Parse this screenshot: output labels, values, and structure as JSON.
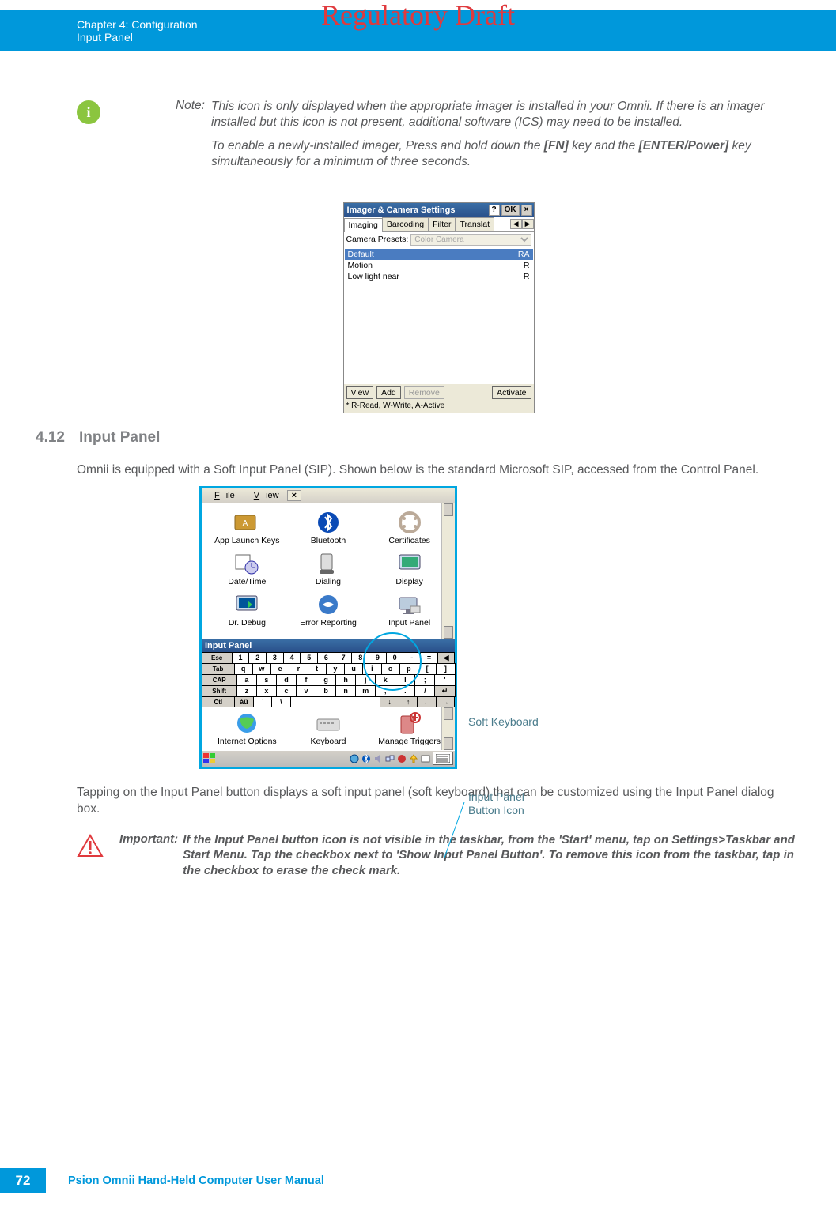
{
  "watermark": "Regulatory Draft",
  "header": {
    "chapter": "Chapter 4:  Configuration",
    "section": "Input Panel"
  },
  "note": {
    "label": "Note:",
    "p1a": "This icon is only displayed when the appropriate imager is installed in your Omnii. If there is an imager installed but this icon is not present, additional software (ICS) may need to be installed.",
    "p2a": "To enable a newly-installed imager, Press and hold down the ",
    "p2b": "[FN]",
    "p2c": " key and the ",
    "p2d": "[ENTER/Power]",
    "p2e": " key simultaneously for a minimum of three seconds."
  },
  "shot1": {
    "title": "Imager & Camera Settings",
    "ok": "OK",
    "tabs": [
      "Imaging",
      "Barcoding",
      "Filter",
      "Translat"
    ],
    "presets_label": "Camera Presets:",
    "presets_value": "Color Camera",
    "rows": [
      {
        "name": "Default",
        "flags": "RA"
      },
      {
        "name": "Motion",
        "flags": "R"
      },
      {
        "name": "Low light near",
        "flags": "R"
      }
    ],
    "buttons": [
      "View",
      "Add",
      "Remove",
      "Activate"
    ],
    "footnote": "* R-Read, W-Write, A-Active"
  },
  "sec": {
    "num": "4.12",
    "title": "Input Panel"
  },
  "para1": "Omnii is equipped with a Soft Input Panel (SIP). Shown below is the standard Microsoft SIP, accessed from the Control Panel.",
  "shot2": {
    "menu": [
      "File",
      "View"
    ],
    "icons_r1": [
      "App Launch Keys",
      "Bluetooth",
      "Certificates"
    ],
    "icons_r2": [
      "Date/Time",
      "Dialing",
      "Display"
    ],
    "icons_r3": [
      "Dr. Debug",
      "Error Reporting",
      "Input Panel"
    ],
    "sip_title": "Input Panel",
    "k1": [
      "Esc",
      "1",
      "2",
      "3",
      "4",
      "5",
      "6",
      "7",
      "8",
      "9",
      "0",
      "-",
      "=",
      "◀"
    ],
    "k2": [
      "Tab",
      "q",
      "w",
      "e",
      "r",
      "t",
      "y",
      "u",
      "i",
      "o",
      "p",
      "[",
      "]"
    ],
    "k3": [
      "CAP",
      "a",
      "s",
      "d",
      "f",
      "g",
      "h",
      "j",
      "k",
      "l",
      ";",
      "'"
    ],
    "k4": [
      "Shift",
      "z",
      "x",
      "c",
      "v",
      "b",
      "n",
      "m",
      ",",
      ".",
      "/",
      "↵"
    ],
    "k5": [
      "Ctl",
      "áü",
      "`",
      "\\",
      " ",
      "↓",
      "↑",
      "←",
      "→"
    ],
    "icons_r4": [
      "Internet Options",
      "Keyboard",
      "Manage Triggers"
    ]
  },
  "callout1": "Soft Keyboard",
  "callout2a": "Input Panel",
  "callout2b": "Button Icon",
  "para2": "Tapping on the Input Panel button displays a soft input panel (soft keyboard) that can be customized using the Input Panel dialog box.",
  "important": {
    "label": "Important:",
    "text": "If the Input Panel button icon is not visible in the taskbar, from the 'Start' menu, tap on Settings>Taskbar and Start Menu. Tap the checkbox next to 'Show Input Panel Button'. To remove this icon from the taskbar, tap in the checkbox to erase the check mark."
  },
  "footer": {
    "page": "72",
    "title": "Psion Omnii Hand-Held Computer User Manual"
  }
}
